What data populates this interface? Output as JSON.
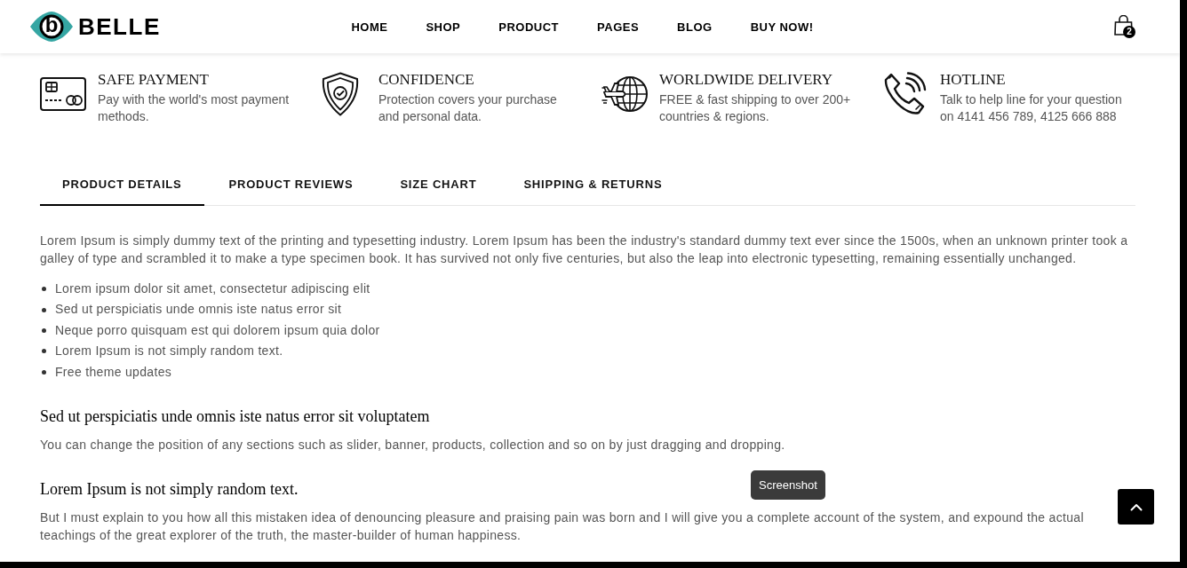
{
  "header": {
    "logo": {
      "mark": "b",
      "name": "BELLE"
    },
    "nav": [
      "HOME",
      "SHOP",
      "PRODUCT",
      "PAGES",
      "BLOG",
      "BUY NOW!"
    ],
    "cart": {
      "count": "2"
    }
  },
  "features": [
    {
      "title": "SAFE PAYMENT",
      "text": "Pay with the world's most payment methods."
    },
    {
      "title": "CONFIDENCE",
      "text": "Protection covers your purchase and personal data."
    },
    {
      "title": "WORLDWIDE DELIVERY",
      "text": "FREE & fast shipping to over 200+ countries & regions."
    },
    {
      "title": "HOTLINE",
      "text": "Talk to help line for your question on 4141 456 789, 4125 666 888"
    }
  ],
  "tabs": [
    {
      "label": "PRODUCT DETAILS",
      "selected": true
    },
    {
      "label": "PRODUCT REVIEWS",
      "selected": false
    },
    {
      "label": "SIZE CHART",
      "selected": false
    },
    {
      "label": "SHIPPING & RETURNS",
      "selected": false
    }
  ],
  "description": {
    "intro": "Lorem Ipsum is simply dummy text of the printing and typesetting industry. Lorem Ipsum has been the industry's standard dummy text ever since the 1500s, when an unknown printer took a galley of type and scrambled it to make a type specimen book. It has survived not only five centuries, but also the leap into electronic typesetting, remaining essentially unchanged.",
    "bullets": [
      "Lorem ipsum dolor sit amet, consectetur adipiscing elit",
      "Sed ut perspiciatis unde omnis iste natus error sit",
      "Neque porro quisquam est qui dolorem ipsum quia dolor",
      "Lorem Ipsum is not simply random text.",
      "Free theme updates"
    ],
    "sections": [
      {
        "heading": "Sed ut perspiciatis unde omnis iste natus error sit voluptatem",
        "text": "You can change the position of any sections such as slider, banner, products, collection and so on by just dragging and dropping."
      },
      {
        "heading": "Lorem Ipsum is not simply random text.",
        "text": "But I must explain to you how all this mistaken idea of denouncing pleasure and praising pain was born and I will give you a complete account of the system, and expound the actual teachings of the great explorer of the truth, the master-builder of human happiness."
      }
    ]
  },
  "tooltip": {
    "text": "Screenshot"
  }
}
